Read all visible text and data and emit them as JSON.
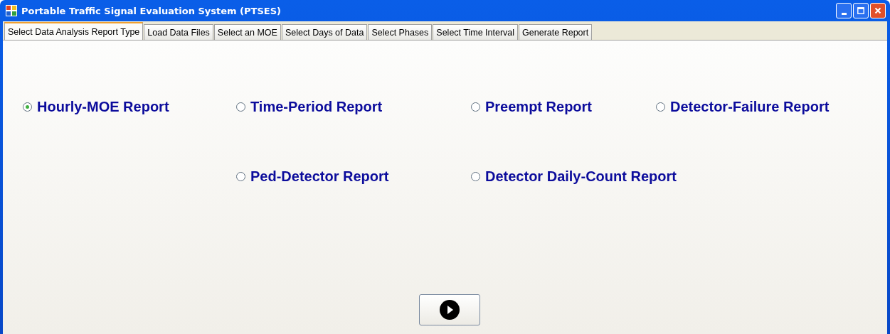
{
  "window": {
    "title": "Portable Traffic Signal Evaluation System (PTSES)"
  },
  "tabs": [
    {
      "label": "Select Data Analysis Report Type",
      "selected": true
    },
    {
      "label": "Load Data Files",
      "selected": false
    },
    {
      "label": "Select an MOE",
      "selected": false
    },
    {
      "label": "Select Days of Data",
      "selected": false
    },
    {
      "label": "Select Phases",
      "selected": false
    },
    {
      "label": "Select Time Interval",
      "selected": false
    },
    {
      "label": "Generate Report",
      "selected": false
    }
  ],
  "report_types": [
    {
      "label": "Hourly-MOE Report",
      "selected": true
    },
    {
      "label": "Time-Period Report",
      "selected": false
    },
    {
      "label": "Preempt Report",
      "selected": false
    },
    {
      "label": "Detector-Failure Report",
      "selected": false
    },
    {
      "label": "Ped-Detector Report",
      "selected": false
    },
    {
      "label": "Detector Daily-Count Report",
      "selected": false
    }
  ]
}
